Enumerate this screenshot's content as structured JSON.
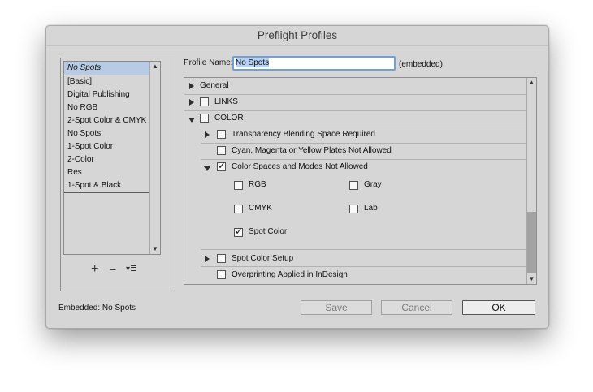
{
  "window": {
    "title": "Preflight Profiles"
  },
  "profiles": {
    "items": [
      "No Spots",
      "[Basic]",
      "Digital Publishing",
      "No RGB",
      "2-Spot Color & CMYK",
      "No Spots",
      "1-Spot Color",
      "2-Color",
      "Res",
      "1-Spot & Black"
    ],
    "selected_index": 0,
    "controls": {
      "add": "+",
      "remove": "−",
      "menu": "▾≣"
    }
  },
  "profile_name": {
    "label": "Profile Name:",
    "value": "No Spots",
    "embedded_tag": "(embedded)"
  },
  "tree": {
    "general": "General",
    "links": "LINKS",
    "color": "COLOR",
    "transparency": "Transparency Blending Space Required",
    "cmy_plates": "Cyan, Magenta or Yellow Plates Not Allowed",
    "color_spaces": "Color Spaces and Modes Not Allowed",
    "options": {
      "rgb": "RGB",
      "gray": "Gray",
      "cmyk": "CMYK",
      "lab": "Lab",
      "spot_color": "Spot Color"
    },
    "spot_setup": "Spot Color Setup",
    "overprinting": "Overprinting Applied in InDesign"
  },
  "footer": {
    "embedded": "Embedded: No Spots"
  },
  "buttons": {
    "save": "Save",
    "cancel": "Cancel",
    "ok": "OK"
  }
}
